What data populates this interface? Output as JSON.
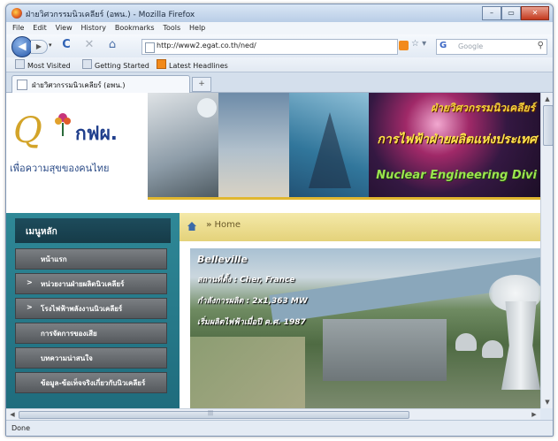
{
  "window": {
    "title": "ฝ่ายวิศวกรรมนิวเคลียร์ (อพน.) - Mozilla Firefox",
    "min_glyph": "–",
    "max_glyph": "▭",
    "close_glyph": "✕"
  },
  "menu": [
    "File",
    "Edit",
    "View",
    "History",
    "Bookmarks",
    "Tools",
    "Help"
  ],
  "nav": {
    "back_glyph": "◀",
    "forward_glyph": "▶",
    "dropdown_glyph": "▾",
    "reload_glyph": "C",
    "stop_glyph": "✕",
    "home_glyph": "⌂",
    "url": "http://www2.egat.co.th/ned/",
    "star_glyph": "☆ ▾",
    "search_engine": "G",
    "search_placeholder": "Google",
    "search_glyph": "⚲"
  },
  "bookmarks": [
    "Most Visited",
    "Getting Started",
    "Latest Headlines"
  ],
  "tabs": [
    {
      "label": "ฝ่ายวิศวกรรมนิวเคลียร์ (อพน.)"
    }
  ],
  "new_tab_glyph": "+",
  "site": {
    "logo_letter": "Q",
    "logo_org": "กฟผ.",
    "logo_slogan": "เพื่อความสุขของคนไทย",
    "banner_line1": "ฝ่ายวิศวกรรมนิวเคลียร์",
    "banner_line2": "การไฟฟ้าฝ่ายผลิตแห่งประเทศ",
    "banner_line3": "Nuclear Engineering Divi",
    "menu_title": "เมนูหลัก",
    "menu_items": [
      {
        "label": "หน้าแรก",
        "arrow": ""
      },
      {
        "label": "หน่วยงานฝ่ายผลิตนิวเคลียร์",
        "arrow": ">"
      },
      {
        "label": "โรงไฟฟ้าพลังงานนิวเคลียร์",
        "arrow": ">"
      },
      {
        "label": "การจัดการของเสีย",
        "arrow": ""
      },
      {
        "label": "บทความน่าสนใจ",
        "arrow": ""
      },
      {
        "label": "ข้อมูล-ข้อเท็จจริงเกี่ยวกับนิวเคลียร์",
        "arrow": ""
      }
    ],
    "breadcrumb_arrow": "»",
    "breadcrumb": "Home",
    "photo": {
      "name": "Belleville",
      "location": "สถานที่ตั้ง : Cher, France",
      "capacity": "กำลังการผลิต : 2x1,363 MW",
      "start": "เริ่มผลิตไฟฟ้าเมื่อปี ค.ศ. 1987"
    }
  },
  "scroll": {
    "up": "▲",
    "down": "▼",
    "left": "◀",
    "right": "▶",
    "grip": "|||"
  },
  "status": "Done",
  "colors": {
    "nav_teal": "#2f8897",
    "menu_item_gray": "#6b6f73",
    "crumb_gold": "#e4d27a",
    "banner_yellow": "#ffe34a",
    "banner_green": "#9be54e"
  }
}
